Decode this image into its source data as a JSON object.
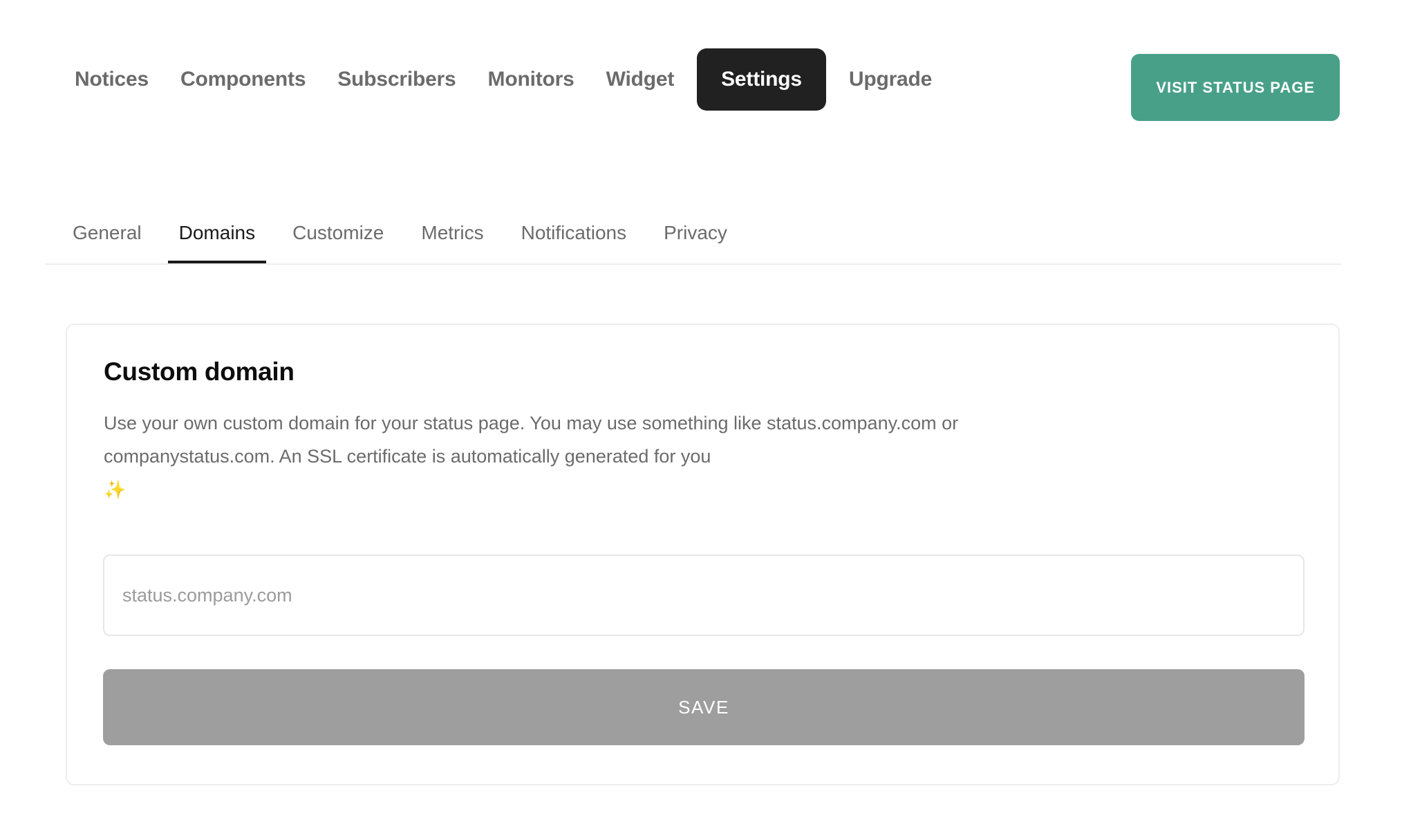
{
  "topnav": {
    "items": [
      {
        "label": "Notices",
        "active": false
      },
      {
        "label": "Components",
        "active": false
      },
      {
        "label": "Subscribers",
        "active": false
      },
      {
        "label": "Monitors",
        "active": false
      },
      {
        "label": "Widget",
        "active": false
      },
      {
        "label": "Settings",
        "active": true
      },
      {
        "label": "Upgrade",
        "active": false
      }
    ],
    "visit_button": {
      "label": "VISIT STATUS PAGE",
      "color": "#48a088",
      "text_color": "#ffffff"
    },
    "active_item_bg": "#212121",
    "item_color": "#6b6b6b"
  },
  "subtabs": {
    "items": [
      {
        "label": "General",
        "active": false
      },
      {
        "label": "Domains",
        "active": true
      },
      {
        "label": "Customize",
        "active": false
      },
      {
        "label": "Metrics",
        "active": false
      },
      {
        "label": "Notifications",
        "active": false
      },
      {
        "label": "Privacy",
        "active": false
      }
    ],
    "active_color": "#1a1a1a",
    "inactive_color": "#6b6b6b",
    "underline_color": "#1a1a1a",
    "divider_color": "#eeeeee"
  },
  "card": {
    "title": "Custom domain",
    "description": "Use your own custom domain for your status page. You may use something like status.company.com or companystatus.com. An SSL certificate is automatically generated for you",
    "description_emoji": "✨",
    "emoji_name": "sparkles-emoji",
    "input": {
      "value": "",
      "placeholder": "status.company.com",
      "placeholder_color": "#9b9b9b"
    },
    "save_button": {
      "label": "SAVE",
      "disabled": true,
      "bg_color": "#9e9e9e",
      "text_color": "#ffffff"
    },
    "border_color": "#ededed"
  }
}
